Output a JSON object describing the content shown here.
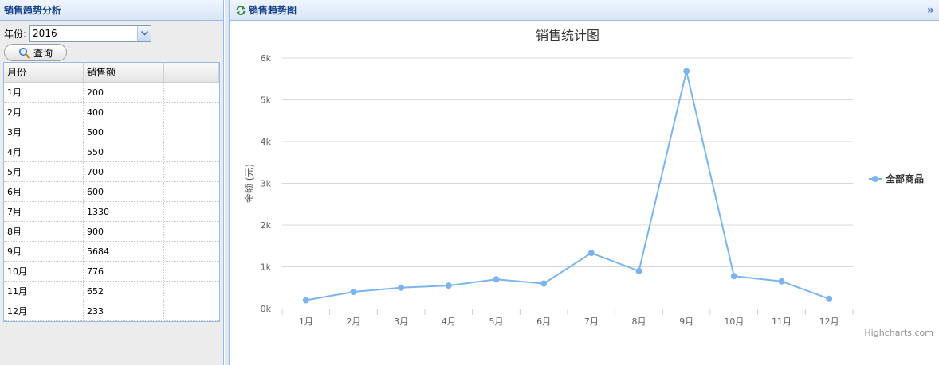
{
  "left_panel": {
    "title": "销售趋势分析",
    "year_label": "年份:",
    "year_value": "2016",
    "query_button": "查询",
    "grid": {
      "headers": [
        "月份",
        "销售额"
      ],
      "rows": [
        [
          "1月",
          "200"
        ],
        [
          "2月",
          "400"
        ],
        [
          "3月",
          "500"
        ],
        [
          "4月",
          "550"
        ],
        [
          "5月",
          "700"
        ],
        [
          "6月",
          "600"
        ],
        [
          "7月",
          "1330"
        ],
        [
          "8月",
          "900"
        ],
        [
          "9月",
          "5684"
        ],
        [
          "10月",
          "776"
        ],
        [
          "11月",
          "652"
        ],
        [
          "12月",
          "233"
        ]
      ]
    }
  },
  "right_panel": {
    "title": "销售趋势图",
    "collapse_glyph": "»",
    "credits": "Highcharts.com"
  },
  "chart_data": {
    "type": "line",
    "title": "销售统计图",
    "ylabel": "金额 (元)",
    "xlabel": "",
    "categories": [
      "1月",
      "2月",
      "3月",
      "4月",
      "5月",
      "6月",
      "7月",
      "8月",
      "9月",
      "10月",
      "11月",
      "12月"
    ],
    "series": [
      {
        "name": "全部商品",
        "values": [
          200,
          400,
          500,
          550,
          700,
          600,
          1330,
          900,
          5684,
          776,
          652,
          233
        ],
        "color": "#7cb5ec"
      }
    ],
    "ylim": [
      0,
      6000
    ],
    "yticks": [
      0,
      1000,
      2000,
      3000,
      4000,
      5000,
      6000
    ],
    "ytick_labels": [
      "0k",
      "1k",
      "2k",
      "3k",
      "4k",
      "5k",
      "6k"
    ],
    "grid": true,
    "legend_position": "right"
  }
}
